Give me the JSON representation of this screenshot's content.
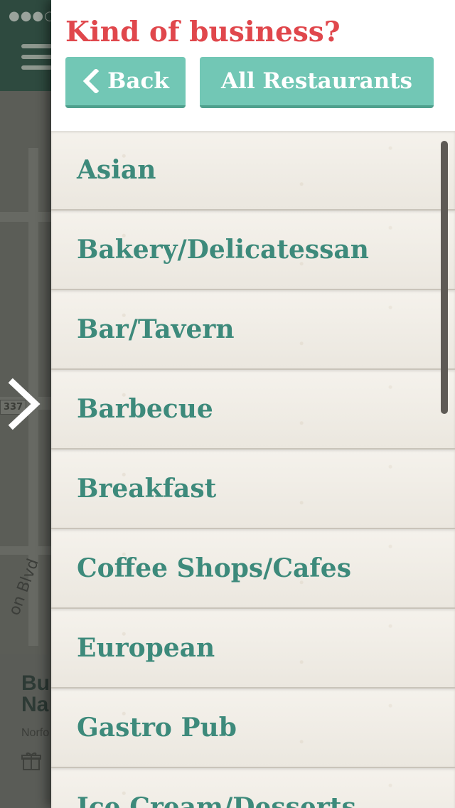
{
  "drawer": {
    "title": "Kind of business?",
    "back_label": "Back",
    "all_label": "All Restaurants",
    "categories": [
      "Asian",
      "Bakery/Delicatessan",
      "Bar/Tavern",
      "Barbecue",
      "Breakfast",
      "Coffee Shops/Cafes",
      "European",
      "Gastro Pub",
      "Ice Cream/Desserts"
    ]
  },
  "background": {
    "status": "●●●○○",
    "map_badge": "337",
    "road_label": "on Blvd",
    "card_title": "Bu\nNa",
    "card_subtitle": "Norfo"
  },
  "colors": {
    "title": "#e0474c",
    "button": "#72c7b5",
    "list_text": "#3d8a7b"
  },
  "icons": {
    "back": "chevron-left-icon",
    "drawer_toggle": "chevron-right-icon",
    "menu": "hamburger-icon",
    "gift": "gift-icon"
  }
}
